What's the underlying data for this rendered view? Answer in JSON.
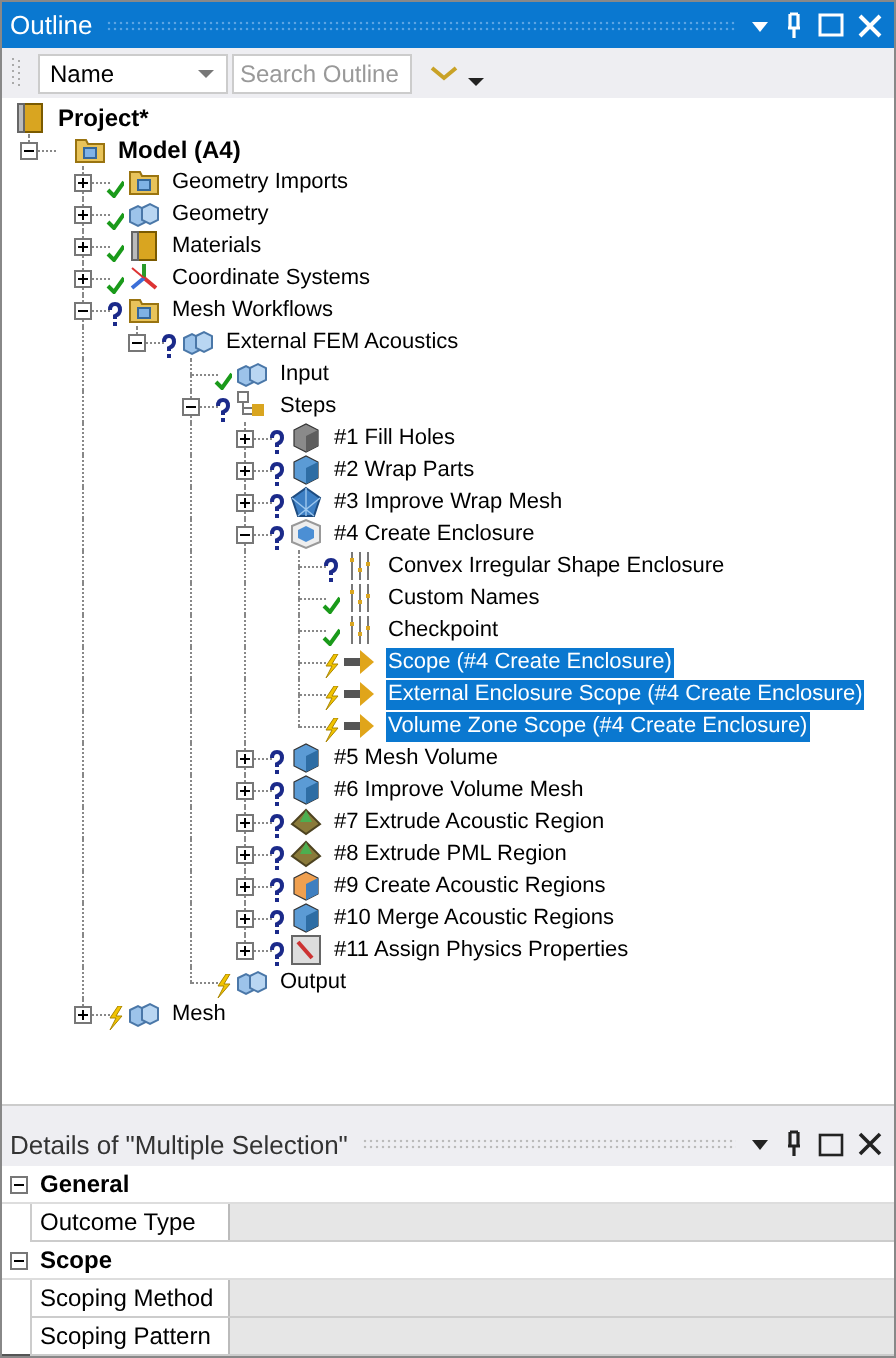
{
  "outline": {
    "title": "Outline",
    "filter": {
      "value": "Name"
    },
    "search": {
      "placeholder": "Search Outline"
    },
    "tree": [
      {
        "label": "Project*",
        "kind": "book",
        "selected": false,
        "children": [
          {
            "label": "Model (A4)",
            "kind": "folder",
            "expanded": true,
            "selected": false,
            "children": [
              {
                "label": "Geometry Imports",
                "kind": "folder",
                "status": {
                  "kind": "check"
                },
                "expanded": false,
                "selected": false
              },
              {
                "label": "Geometry",
                "kind": "cubes",
                "status": {
                  "kind": "check"
                },
                "expanded": false,
                "selected": false
              },
              {
                "label": "Materials",
                "kind": "book",
                "status": {
                  "kind": "check"
                },
                "expanded": false,
                "selected": false
              },
              {
                "label": "Coordinate Systems",
                "kind": "axes",
                "status": {
                  "kind": "check"
                },
                "expanded": false,
                "selected": false
              },
              {
                "label": "Mesh Workflows",
                "kind": "folder",
                "status": {
                  "kind": "question"
                },
                "expanded": true,
                "selected": false,
                "children": [
                  {
                    "label": "External FEM Acoustics",
                    "kind": "cubes",
                    "status": {
                      "kind": "question"
                    },
                    "expanded": true,
                    "selected": false,
                    "children": [
                      {
                        "label": "Input",
                        "kind": "cubes",
                        "status": {
                          "kind": "check"
                        },
                        "selected": false
                      },
                      {
                        "label": "Steps",
                        "kind": "hierarchy",
                        "status": {
                          "kind": "question"
                        },
                        "expanded": true,
                        "selected": false,
                        "children": [
                          {
                            "label": "#1 Fill Holes",
                            "kind": "graycube",
                            "status": {
                              "kind": "question"
                            },
                            "expanded": false,
                            "selected": false
                          },
                          {
                            "label": "#2 Wrap Parts",
                            "kind": "bluecube",
                            "status": {
                              "kind": "question"
                            },
                            "expanded": false,
                            "selected": false
                          },
                          {
                            "label": "#3 Improve Wrap Mesh",
                            "kind": "mesh",
                            "status": {
                              "kind": "question"
                            },
                            "expanded": false,
                            "selected": false
                          },
                          {
                            "label": "#4 Create Enclosure",
                            "kind": "enclosure",
                            "status": {
                              "kind": "question"
                            },
                            "expanded": true,
                            "selected": false,
                            "children": [
                              {
                                "label": "Convex Irregular Shape Enclosure",
                                "kind": "bars",
                                "status": {
                                  "kind": "question"
                                },
                                "selected": false
                              },
                              {
                                "label": "Custom Names",
                                "kind": "bars",
                                "status": {
                                  "kind": "check"
                                },
                                "selected": false
                              },
                              {
                                "label": "Checkpoint",
                                "kind": "bars",
                                "status": {
                                  "kind": "check"
                                },
                                "selected": false
                              },
                              {
                                "label": "Scope (#4 Create Enclosure)",
                                "kind": "arrow",
                                "status": {
                                  "kind": "lightning"
                                },
                                "selected": true
                              },
                              {
                                "label": "External Enclosure Scope (#4 Create Enclosure)",
                                "kind": "arrow",
                                "status": {
                                  "kind": "lightning"
                                },
                                "selected": true
                              },
                              {
                                "label": "Volume Zone Scope  (#4 Create Enclosure)",
                                "kind": "arrow",
                                "status": {
                                  "kind": "lightning"
                                },
                                "selected": true
                              }
                            ]
                          },
                          {
                            "label": "#5 Mesh Volume",
                            "kind": "bluecube",
                            "status": {
                              "kind": "question"
                            },
                            "expanded": false,
                            "selected": false
                          },
                          {
                            "label": "#6 Improve Volume Mesh",
                            "kind": "bluecube",
                            "status": {
                              "kind": "question"
                            },
                            "expanded": false,
                            "selected": false
                          },
                          {
                            "label": "#7 Extrude Acoustic Region",
                            "kind": "pyramid",
                            "status": {
                              "kind": "question"
                            },
                            "expanded": false,
                            "selected": false
                          },
                          {
                            "label": "#8 Extrude PML Region",
                            "kind": "pyramid",
                            "status": {
                              "kind": "question"
                            },
                            "expanded": false,
                            "selected": false
                          },
                          {
                            "label": "#9 Create Acoustic Regions",
                            "kind": "orangecube",
                            "status": {
                              "kind": "question"
                            },
                            "expanded": false,
                            "selected": false
                          },
                          {
                            "label": "#10 Merge Acoustic Regions",
                            "kind": "bluecube",
                            "status": {
                              "kind": "question"
                            },
                            "expanded": false,
                            "selected": false
                          },
                          {
                            "label": "#11 Assign Physics Properties",
                            "kind": "props",
                            "status": {
                              "kind": "question"
                            },
                            "expanded": false,
                            "selected": false
                          }
                        ]
                      },
                      {
                        "label": "Output",
                        "kind": "cubes",
                        "status": {
                          "kind": "lightning"
                        },
                        "selected": false
                      }
                    ]
                  }
                ]
              },
              {
                "label": "Mesh",
                "kind": "cubes",
                "status": {
                  "kind": "lightning"
                },
                "expanded": false,
                "selected": false
              }
            ]
          }
        ]
      }
    ]
  },
  "details": {
    "title": "Details of \"Multiple Selection\"",
    "groups": [
      {
        "label": "General",
        "expanded": true,
        "rows": [
          {
            "label": "Outcome Type"
          }
        ]
      },
      {
        "label": "Scope",
        "expanded": true,
        "rows": [
          {
            "label": "Scoping Method"
          },
          {
            "label": "Scoping Pattern"
          }
        ]
      }
    ]
  }
}
